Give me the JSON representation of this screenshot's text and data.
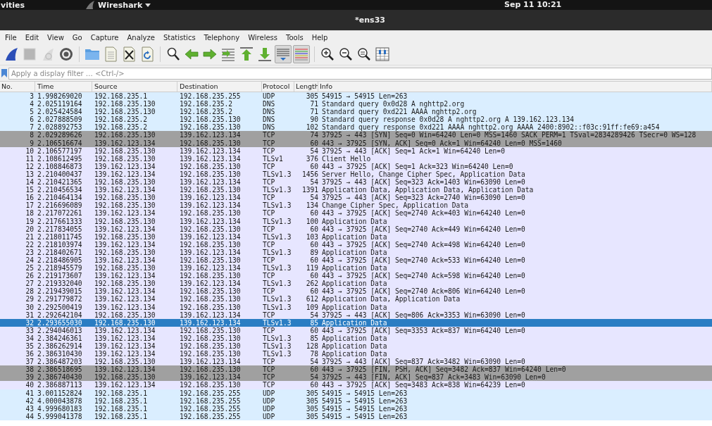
{
  "top_bar": {
    "activities": "vities",
    "app_menu": "Wireshark",
    "clock": "Sep 11  10:21"
  },
  "window": {
    "title": "*ens33"
  },
  "menu": [
    "File",
    "Edit",
    "View",
    "Go",
    "Capture",
    "Analyze",
    "Statistics",
    "Telephony",
    "Wireless",
    "Tools",
    "Help"
  ],
  "toolbar": [
    {
      "kind": "fin",
      "pressed": false,
      "disabled": false
    },
    {
      "kind": "stop",
      "pressed": false,
      "disabled": true
    },
    {
      "kind": "restart",
      "pressed": false,
      "disabled": true
    },
    {
      "kind": "gear",
      "pressed": false,
      "disabled": false
    },
    {
      "kind": "sep"
    },
    {
      "kind": "folder",
      "pressed": false,
      "disabled": false
    },
    {
      "kind": "file",
      "pressed": false,
      "disabled": false
    },
    {
      "kind": "closefile",
      "pressed": false,
      "disabled": false
    },
    {
      "kind": "reload",
      "pressed": false,
      "disabled": false
    },
    {
      "kind": "sep"
    },
    {
      "kind": "search",
      "pressed": false,
      "disabled": false
    },
    {
      "kind": "left",
      "pressed": false,
      "disabled": false
    },
    {
      "kind": "right",
      "pressed": false,
      "disabled": false
    },
    {
      "kind": "jump",
      "pressed": false,
      "disabled": false
    },
    {
      "kind": "first",
      "pressed": false,
      "disabled": false
    },
    {
      "kind": "last",
      "pressed": false,
      "disabled": false
    },
    {
      "kind": "autoscroll",
      "pressed": true,
      "disabled": false
    },
    {
      "kind": "colorize",
      "pressed": true,
      "disabled": false
    },
    {
      "kind": "sep"
    },
    {
      "kind": "zoomin",
      "pressed": false,
      "disabled": false
    },
    {
      "kind": "zoomout",
      "pressed": false,
      "disabled": false
    },
    {
      "kind": "zoomreset",
      "pressed": false,
      "disabled": false
    },
    {
      "kind": "columns",
      "pressed": false,
      "disabled": false
    }
  ],
  "filter": {
    "placeholder": "Apply a display filter … <Ctrl-/>"
  },
  "packet_list": {
    "columns": [
      "No.",
      "Time",
      "Source",
      "Destination",
      "Protocol",
      "Length",
      "Info"
    ],
    "rows": [
      {
        "no": "3",
        "time": "1.998269020",
        "source": "192.168.235.1",
        "destination": "192.168.235.255",
        "protocol": "UDP",
        "length": "305",
        "info": "54915 → 54915 Len=263",
        "color": "#daeeff",
        "selected": false
      },
      {
        "no": "4",
        "time": "2.025119164",
        "source": "192.168.235.130",
        "destination": "192.168.235.2",
        "protocol": "DNS",
        "length": "71",
        "info": "Standard query 0x0d28 A nghttp2.org",
        "color": "#daeeff",
        "selected": false
      },
      {
        "no": "5",
        "time": "2.025424584",
        "source": "192.168.235.130",
        "destination": "192.168.235.2",
        "protocol": "DNS",
        "length": "71",
        "info": "Standard query 0xd221 AAAA nghttp2.org",
        "color": "#daeeff",
        "selected": false
      },
      {
        "no": "6",
        "time": "2.027888509",
        "source": "192.168.235.2",
        "destination": "192.168.235.130",
        "protocol": "DNS",
        "length": "90",
        "info": "Standard query response 0x0d28 A nghttp2.org A 139.162.123.134",
        "color": "#daeeff",
        "selected": false
      },
      {
        "no": "7",
        "time": "2.028892753",
        "source": "192.168.235.2",
        "destination": "192.168.235.130",
        "protocol": "DNS",
        "length": "102",
        "info": "Standard query response 0xd221 AAAA nghttp2.org AAAA 2400:8902::f03c:91ff:fe69:a454",
        "color": "#daeeff",
        "selected": false
      },
      {
        "no": "8",
        "time": "2.029289626",
        "source": "192.168.235.130",
        "destination": "139.162.123.134",
        "protocol": "TCP",
        "length": "74",
        "info": "37925 → 443 [SYN] Seq=0 Win=64240 Len=0 MSS=1460 SACK_PERM=1 TSval=2834289426 TSecr=0 WS=128",
        "color": "#a0a0a0",
        "selected": false
      },
      {
        "no": "9",
        "time": "2.106516674",
        "source": "139.162.123.134",
        "destination": "192.168.235.130",
        "protocol": "TCP",
        "length": "60",
        "info": "443 → 37925 [SYN, ACK] Seq=0 Ack=1 Win=64240 Len=0 MSS=1460",
        "color": "#a0a0a0",
        "selected": false
      },
      {
        "no": "10",
        "time": "2.106577197",
        "source": "192.168.235.130",
        "destination": "139.162.123.134",
        "protocol": "TCP",
        "length": "54",
        "info": "37925 → 443 [ACK] Seq=1 Ack=1 Win=64240 Len=0",
        "color": "#e7e6ff",
        "selected": false
      },
      {
        "no": "11",
        "time": "2.108612495",
        "source": "192.168.235.130",
        "destination": "139.162.123.134",
        "protocol": "TLSv1",
        "length": "376",
        "info": "Client Hello",
        "color": "#e7e6ff",
        "selected": false
      },
      {
        "no": "12",
        "time": "2.108846873",
        "source": "139.162.123.134",
        "destination": "192.168.235.130",
        "protocol": "TCP",
        "length": "60",
        "info": "443 → 37925 [ACK] Seq=1 Ack=323 Win=64240 Len=0",
        "color": "#e7e6ff",
        "selected": false
      },
      {
        "no": "13",
        "time": "2.210400437",
        "source": "139.162.123.134",
        "destination": "192.168.235.130",
        "protocol": "TLSv1.3",
        "length": "1456",
        "info": "Server Hello, Change Cipher Spec, Application Data",
        "color": "#e7e6ff",
        "selected": false
      },
      {
        "no": "14",
        "time": "2.210421365",
        "source": "192.168.235.130",
        "destination": "139.162.123.134",
        "protocol": "TCP",
        "length": "54",
        "info": "37925 → 443 [ACK] Seq=323 Ack=1403 Win=63090 Len=0",
        "color": "#e7e6ff",
        "selected": false
      },
      {
        "no": "15",
        "time": "2.210456534",
        "source": "139.162.123.134",
        "destination": "192.168.235.130",
        "protocol": "TLSv1.3",
        "length": "1391",
        "info": "Application Data, Application Data, Application Data",
        "color": "#e7e6ff",
        "selected": false
      },
      {
        "no": "16",
        "time": "2.210464134",
        "source": "192.168.235.130",
        "destination": "139.162.123.134",
        "protocol": "TCP",
        "length": "54",
        "info": "37925 → 443 [ACK] Seq=323 Ack=2740 Win=63090 Len=0",
        "color": "#e7e6ff",
        "selected": false
      },
      {
        "no": "17",
        "time": "2.216696089",
        "source": "192.168.235.130",
        "destination": "139.162.123.134",
        "protocol": "TLSv1.3",
        "length": "134",
        "info": "Change Cipher Spec, Application Data",
        "color": "#e7e6ff",
        "selected": false
      },
      {
        "no": "18",
        "time": "2.217072261",
        "source": "139.162.123.134",
        "destination": "192.168.235.130",
        "protocol": "TCP",
        "length": "60",
        "info": "443 → 37925 [ACK] Seq=2740 Ack=403 Win=64240 Len=0",
        "color": "#e7e6ff",
        "selected": false
      },
      {
        "no": "19",
        "time": "2.217661333",
        "source": "192.168.235.130",
        "destination": "139.162.123.134",
        "protocol": "TLSv1.3",
        "length": "100",
        "info": "Application Data",
        "color": "#e7e6ff",
        "selected": false
      },
      {
        "no": "20",
        "time": "2.217834055",
        "source": "139.162.123.134",
        "destination": "192.168.235.130",
        "protocol": "TCP",
        "length": "60",
        "info": "443 → 37925 [ACK] Seq=2740 Ack=449 Win=64240 Len=0",
        "color": "#e7e6ff",
        "selected": false
      },
      {
        "no": "21",
        "time": "2.218011745",
        "source": "192.168.235.130",
        "destination": "139.162.123.134",
        "protocol": "TLSv1.3",
        "length": "103",
        "info": "Application Data",
        "color": "#e7e6ff",
        "selected": false
      },
      {
        "no": "22",
        "time": "2.218103974",
        "source": "139.162.123.134",
        "destination": "192.168.235.130",
        "protocol": "TCP",
        "length": "60",
        "info": "443 → 37925 [ACK] Seq=2740 Ack=498 Win=64240 Len=0",
        "color": "#e7e6ff",
        "selected": false
      },
      {
        "no": "23",
        "time": "2.218402671",
        "source": "192.168.235.130",
        "destination": "139.162.123.134",
        "protocol": "TLSv1.3",
        "length": "89",
        "info": "Application Data",
        "color": "#e7e6ff",
        "selected": false
      },
      {
        "no": "24",
        "time": "2.218486905",
        "source": "139.162.123.134",
        "destination": "192.168.235.130",
        "protocol": "TCP",
        "length": "60",
        "info": "443 → 37925 [ACK] Seq=2740 Ack=533 Win=64240 Len=0",
        "color": "#e7e6ff",
        "selected": false
      },
      {
        "no": "25",
        "time": "2.218945579",
        "source": "192.168.235.130",
        "destination": "139.162.123.134",
        "protocol": "TLSv1.3",
        "length": "119",
        "info": "Application Data",
        "color": "#e7e6ff",
        "selected": false
      },
      {
        "no": "26",
        "time": "2.219173607",
        "source": "139.162.123.134",
        "destination": "192.168.235.130",
        "protocol": "TCP",
        "length": "60",
        "info": "443 → 37925 [ACK] Seq=2740 Ack=598 Win=64240 Len=0",
        "color": "#e7e6ff",
        "selected": false
      },
      {
        "no": "27",
        "time": "2.219332040",
        "source": "192.168.235.130",
        "destination": "139.162.123.134",
        "protocol": "TLSv1.3",
        "length": "262",
        "info": "Application Data",
        "color": "#e7e6ff",
        "selected": false
      },
      {
        "no": "28",
        "time": "2.219439015",
        "source": "139.162.123.134",
        "destination": "192.168.235.130",
        "protocol": "TCP",
        "length": "60",
        "info": "443 → 37925 [ACK] Seq=2740 Ack=806 Win=64240 Len=0",
        "color": "#e7e6ff",
        "selected": false
      },
      {
        "no": "29",
        "time": "2.291779872",
        "source": "139.162.123.134",
        "destination": "192.168.235.130",
        "protocol": "TLSv1.3",
        "length": "612",
        "info": "Application Data, Application Data",
        "color": "#e7e6ff",
        "selected": false
      },
      {
        "no": "30",
        "time": "2.292500419",
        "source": "139.162.123.134",
        "destination": "192.168.235.130",
        "protocol": "TLSv1.3",
        "length": "109",
        "info": "Application Data",
        "color": "#e7e6ff",
        "selected": false
      },
      {
        "no": "31",
        "time": "2.292642104",
        "source": "192.168.235.130",
        "destination": "139.162.123.134",
        "protocol": "TCP",
        "length": "54",
        "info": "37925 → 443 [ACK] Seq=806 Ack=3353 Win=63090 Len=0",
        "color": "#e7e6ff",
        "selected": false
      },
      {
        "no": "32",
        "time": "2.293655030",
        "source": "192.168.235.130",
        "destination": "139.162.123.134",
        "protocol": "TLSv1.3",
        "length": "85",
        "info": "Application Data",
        "selected": true
      },
      {
        "no": "33",
        "time": "2.294046013",
        "source": "139.162.123.134",
        "destination": "192.168.235.130",
        "protocol": "TCP",
        "length": "60",
        "info": "443 → 37925 [ACK] Seq=3353 Ack=837 Win=64240 Len=0",
        "color": "#e7e6ff",
        "selected": false
      },
      {
        "no": "34",
        "time": "2.384246361",
        "source": "139.162.123.134",
        "destination": "192.168.235.130",
        "protocol": "TLSv1.3",
        "length": "85",
        "info": "Application Data",
        "color": "#e7e6ff",
        "selected": false
      },
      {
        "no": "35",
        "time": "2.386262914",
        "source": "139.162.123.134",
        "destination": "192.168.235.130",
        "protocol": "TLSv1.3",
        "length": "128",
        "info": "Application Data",
        "color": "#e7e6ff",
        "selected": false
      },
      {
        "no": "36",
        "time": "2.386310430",
        "source": "139.162.123.134",
        "destination": "192.168.235.130",
        "protocol": "TLSv1.3",
        "length": "78",
        "info": "Application Data",
        "color": "#e7e6ff",
        "selected": false
      },
      {
        "no": "37",
        "time": "2.386487203",
        "source": "192.168.235.130",
        "destination": "139.162.123.134",
        "protocol": "TCP",
        "length": "54",
        "info": "37925 → 443 [ACK] Seq=837 Ack=3482 Win=63090 Len=0",
        "color": "#e7e6ff",
        "selected": false
      },
      {
        "no": "38",
        "time": "2.386518695",
        "source": "139.162.123.134",
        "destination": "192.168.235.130",
        "protocol": "TCP",
        "length": "60",
        "info": "443 → 37925 [FIN, PSH, ACK] Seq=3482 Ack=837 Win=64240 Len=0",
        "color": "#a0a0a0",
        "selected": false
      },
      {
        "no": "39",
        "time": "2.386740430",
        "source": "192.168.235.130",
        "destination": "139.162.123.134",
        "protocol": "TCP",
        "length": "54",
        "info": "37925 → 443 [FIN, ACK] Seq=837 Ack=3483 Win=63090 Len=0",
        "color": "#a0a0a0",
        "selected": false
      },
      {
        "no": "40",
        "time": "2.386887113",
        "source": "139.162.123.134",
        "destination": "192.168.235.130",
        "protocol": "TCP",
        "length": "60",
        "info": "443 → 37925 [ACK] Seq=3483 Ack=838 Win=64239 Len=0",
        "color": "#e7e6ff",
        "selected": false
      },
      {
        "no": "41",
        "time": "3.001152824",
        "source": "192.168.235.1",
        "destination": "192.168.235.255",
        "protocol": "UDP",
        "length": "305",
        "info": "54915 → 54915 Len=263",
        "color": "#daeeff",
        "selected": false
      },
      {
        "no": "42",
        "time": "4.000043878",
        "source": "192.168.235.1",
        "destination": "192.168.235.255",
        "protocol": "UDP",
        "length": "305",
        "info": "54915 → 54915 Len=263",
        "color": "#daeeff",
        "selected": false
      },
      {
        "no": "43",
        "time": "4.999680183",
        "source": "192.168.235.1",
        "destination": "192.168.235.255",
        "protocol": "UDP",
        "length": "305",
        "info": "54915 → 54915 Len=263",
        "color": "#daeeff",
        "selected": false
      },
      {
        "no": "44",
        "time": "5.999041378",
        "source": "192.168.235.1",
        "destination": "192.168.235.255",
        "protocol": "UDP",
        "length": "305",
        "info": "54915 → 54915 Len=263",
        "color": "#daeeff",
        "selected": false
      }
    ]
  }
}
